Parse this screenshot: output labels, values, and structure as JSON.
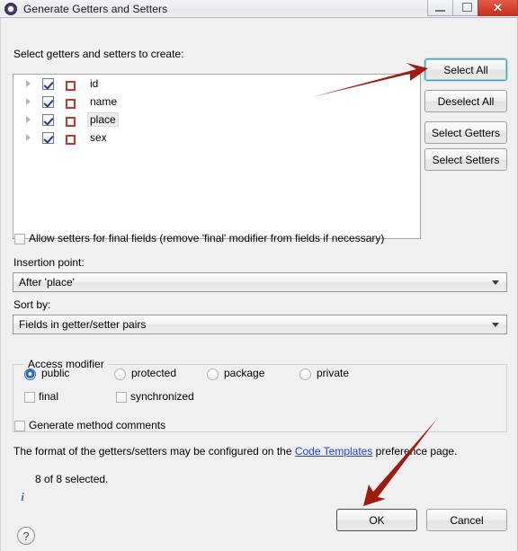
{
  "window": {
    "title": "Generate Getters and Setters",
    "icon": "eclipse-wizard-icon",
    "controls": {
      "minimize": "minimize-icon",
      "maximize": "maximize-icon",
      "close": "✕"
    }
  },
  "main": {
    "instruction": "Select getters and setters to create:"
  },
  "tree": {
    "items": [
      {
        "label": "id",
        "checked": true,
        "selected": false,
        "icon": "private-field-icon"
      },
      {
        "label": "name",
        "checked": true,
        "selected": false,
        "icon": "private-field-icon"
      },
      {
        "label": "place",
        "checked": true,
        "selected": true,
        "icon": "private-field-icon"
      },
      {
        "label": "sex",
        "checked": true,
        "selected": false,
        "icon": "private-field-icon"
      }
    ]
  },
  "side_buttons": [
    {
      "label": "Select All",
      "focused": true
    },
    {
      "label": "Deselect All",
      "focused": false
    },
    {
      "label": "Select Getters",
      "focused": false
    },
    {
      "label": "Select Setters",
      "focused": false
    }
  ],
  "options": {
    "allow_final_setters": {
      "label": "Allow setters for final fields (remove 'final' modifier from fields if necessary)",
      "checked": false
    },
    "generate_comments": {
      "label": "Generate method comments",
      "checked": false
    }
  },
  "insertion_point": {
    "label": "Insertion point:",
    "value": "After 'place'"
  },
  "sort_by": {
    "label": "Sort by:",
    "value": "Fields in getter/setter pairs"
  },
  "access_modifier": {
    "title": "Access modifier",
    "radios": [
      {
        "label": "public",
        "selected": true
      },
      {
        "label": "protected",
        "selected": false
      },
      {
        "label": "package",
        "selected": false
      },
      {
        "label": "private",
        "selected": false
      }
    ],
    "checkboxes": [
      {
        "label": "final",
        "checked": false
      },
      {
        "label": "synchronized",
        "checked": false
      }
    ]
  },
  "footer_note": {
    "prefix": "The format of the getters/setters may be configured on the ",
    "link": "Code Templates",
    "suffix": " preference page."
  },
  "status": {
    "icon": "info-icon",
    "text": "8 of 8 selected."
  },
  "dialog_buttons": {
    "help": "?",
    "ok": "OK",
    "cancel": "Cancel"
  },
  "annotations": {
    "arrow_color": "#9e1b10",
    "arrow_to_select_all": "arrow pointing to Select All button",
    "arrow_to_ok": "arrow pointing to OK button"
  }
}
